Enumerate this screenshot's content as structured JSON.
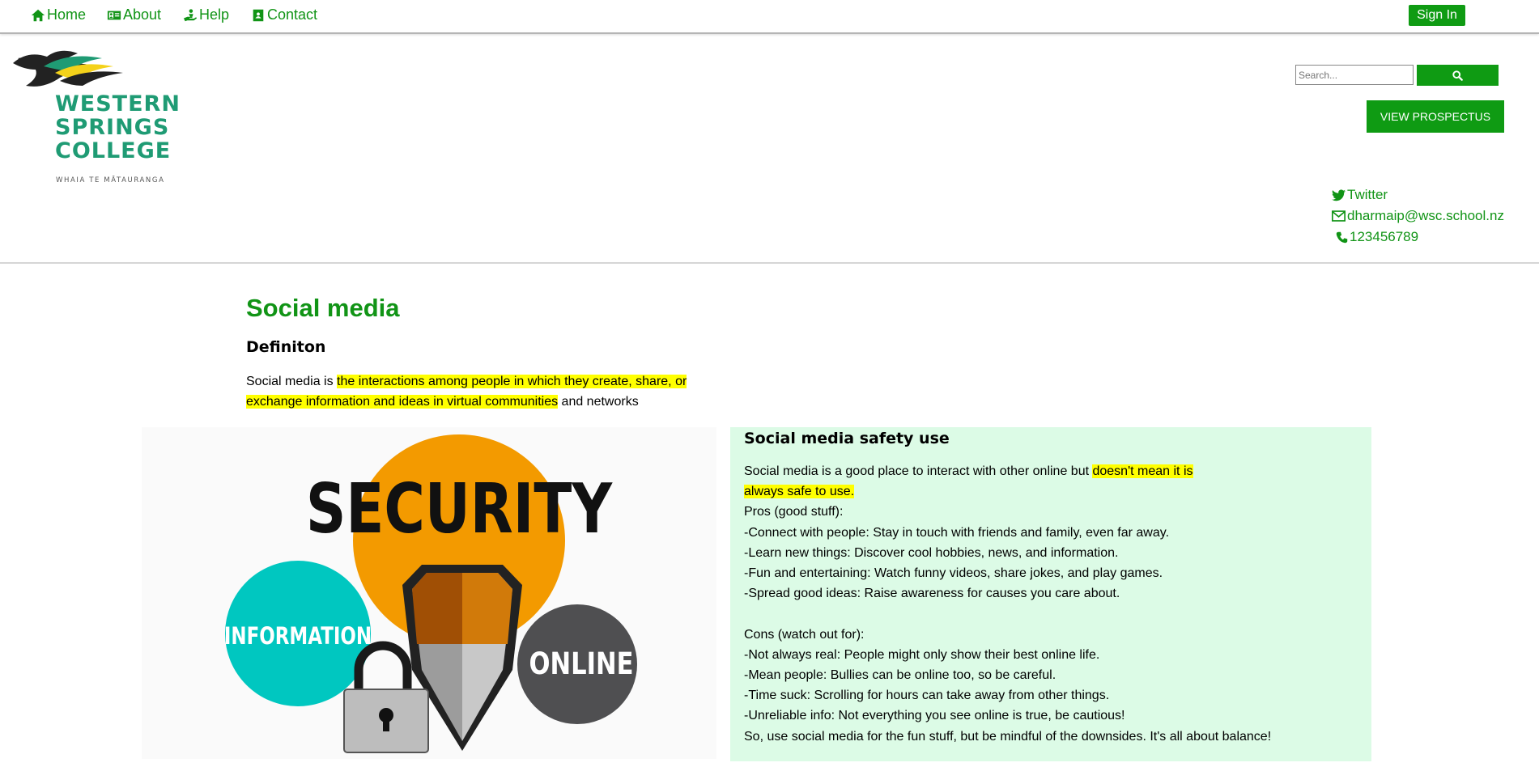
{
  "nav": {
    "home": "Home",
    "about": "About",
    "help": "Help",
    "contact": "Contact",
    "signin": "Sign In"
  },
  "logo": {
    "line1": "WESTERN",
    "line2": "SPRINGS",
    "line3": "COLLEGE",
    "tagline": "WHAIA TE MĀTAURANGA"
  },
  "search": {
    "placeholder": "Search..."
  },
  "prospectus_label": "VIEW PROSPECTUS",
  "contacts": {
    "twitter": "Twitter",
    "email": "dharmaip@wsc.school.nz",
    "phone": "123456789"
  },
  "main": {
    "title": "Social media",
    "definition_heading": "Definiton",
    "def_pre": "Social media is ",
    "def_highlight_1": "the interactions among people in which they create, share, or",
    "def_highlight_2": "exchange information and ideas in virtual communities",
    "def_post": " and networks"
  },
  "image": {
    "word_security": "SECURITY",
    "word_information": "INFORMATION",
    "word_online": "ONLINE"
  },
  "safety": {
    "title": "Social media safety use",
    "intro_pre": "Social media is a good place to interact with other online but ",
    "intro_highlight_1": "doesn't mean it is",
    "intro_highlight_2": "always safe to use.",
    "pros_heading": "Pros (good stuff):",
    "pros": [
      "-Connect with people: Stay in touch with friends and family, even far away.",
      "-Learn new things: Discover cool hobbies, news, and information.",
      "-Fun and entertaining: Watch funny videos, share jokes, and play games.",
      "-Spread good ideas: Raise awareness for causes you care about."
    ],
    "cons_heading": "Cons (watch out for):",
    "cons": [
      "-Not always real: People might only show their best online life.",
      "-Mean people: Bullies can be online too, so be careful.",
      "-Time suck: Scrolling for hours can take away from other things.",
      "-Unreliable info: Not everything you see online is true, be cautious!"
    ],
    "conclusion": "So, use social media for the fun stuff, but be mindful of the downsides. It's all about balance!"
  },
  "colors": {
    "accent": "#119416",
    "button": "#0f9b13",
    "highlight": "#ffff00",
    "panel_bg": "#dcfbe6",
    "logo_green": "#1f9b74"
  }
}
